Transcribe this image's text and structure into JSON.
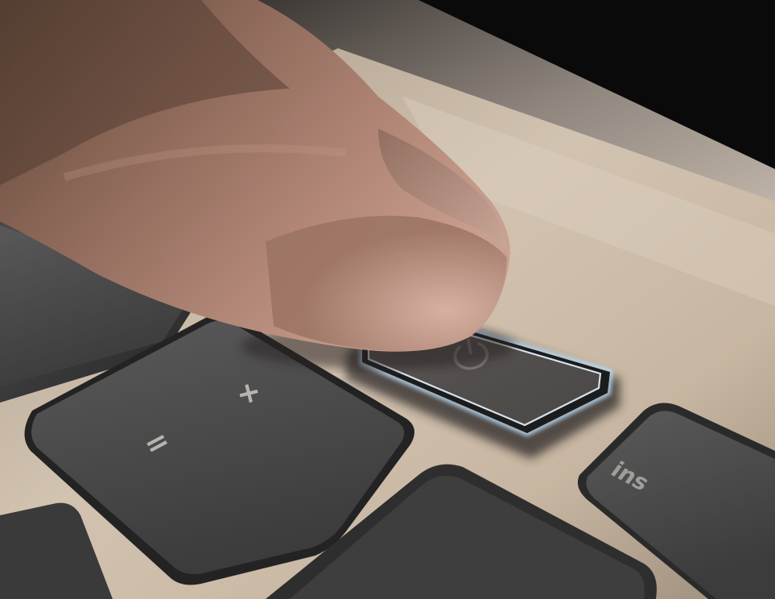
{
  "keys": {
    "plus_key": {
      "legend": "+",
      "icon": "plus-icon"
    },
    "equals_key": {
      "legend": "="
    },
    "ins_key": {
      "legend": "ins"
    },
    "power_key": {
      "icon": "power-icon",
      "backlight_color": "#bfe4ff"
    }
  },
  "colors": {
    "key_cap": "#3a3a3b",
    "deck": "#c9b8a4",
    "skin": "#b58a72",
    "background": "#0b0a0a"
  }
}
